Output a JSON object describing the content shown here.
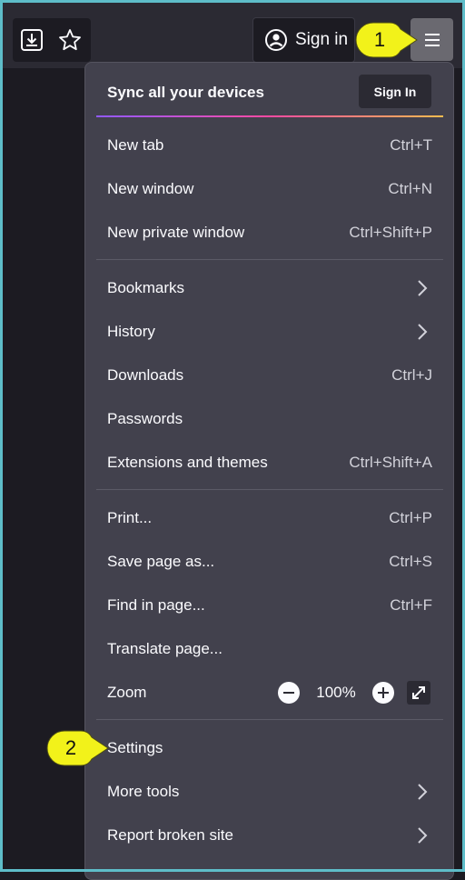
{
  "toolbar": {
    "download_icon": "download-icon",
    "bookmark_icon": "star-icon",
    "signin_label": "Sign in",
    "account_icon": "account-icon",
    "menu_icon": "hamburger-menu-icon"
  },
  "menu": {
    "sync_title": "Sync all your devices",
    "sync_button": "Sign In",
    "items": [
      {
        "label": "New tab",
        "shortcut": "Ctrl+T"
      },
      {
        "label": "New window",
        "shortcut": "Ctrl+N"
      },
      {
        "label": "New private window",
        "shortcut": "Ctrl+Shift+P"
      },
      {
        "label": "Bookmarks",
        "shortcut": ""
      },
      {
        "label": "History",
        "shortcut": ""
      },
      {
        "label": "Downloads",
        "shortcut": "Ctrl+J"
      },
      {
        "label": "Passwords",
        "shortcut": ""
      },
      {
        "label": "Extensions and themes",
        "shortcut": "Ctrl+Shift+A"
      },
      {
        "label": "Print...",
        "shortcut": "Ctrl+P"
      },
      {
        "label": "Save page as...",
        "shortcut": "Ctrl+S"
      },
      {
        "label": "Find in page...",
        "shortcut": "Ctrl+F"
      },
      {
        "label": "Translate page...",
        "shortcut": ""
      },
      {
        "label": "Zoom",
        "value": "100%"
      },
      {
        "label": "Settings",
        "shortcut": ""
      },
      {
        "label": "More tools",
        "shortcut": ""
      },
      {
        "label": "Report broken site",
        "shortcut": ""
      }
    ]
  },
  "callouts": {
    "first": "1",
    "second": "2"
  },
  "colors": {
    "callout": "#f2f21a",
    "frame": "#5ebdc9",
    "panel": "#42414d",
    "gradient": [
      "#9059ff",
      "#ff4aa2",
      "#ffbd4f"
    ]
  }
}
